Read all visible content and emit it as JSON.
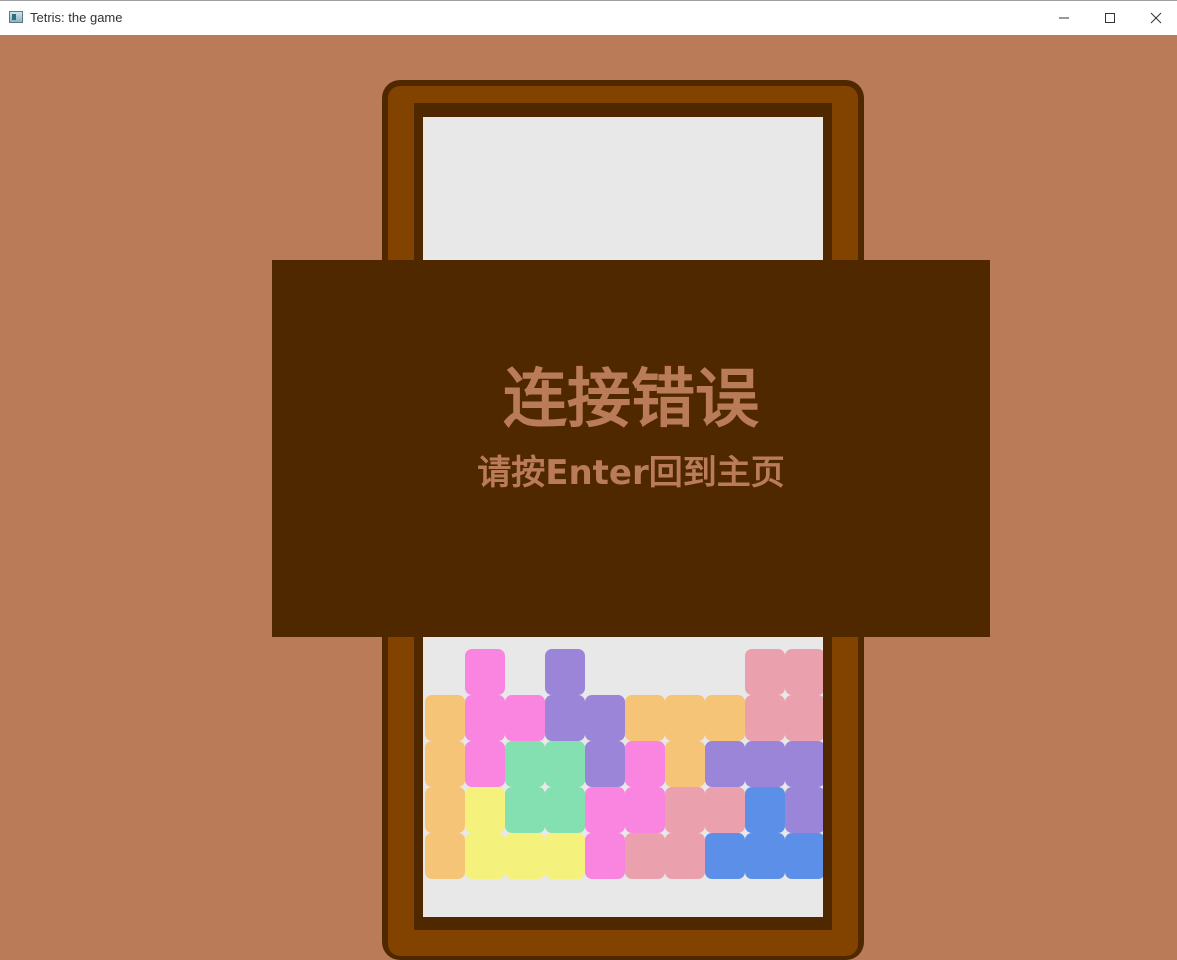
{
  "window": {
    "title": "Tetris: the game",
    "controls": [
      "minimize",
      "maximize",
      "close"
    ]
  },
  "colors": {
    "background": "#b97b58",
    "frame_dark": "#4f2800",
    "frame_mid": "#824200",
    "board": "#e8e8e8",
    "overlay": "#4f2800",
    "text": "#b97b58",
    "piece_orange": "#f6c476",
    "piece_pink": "#f985e0",
    "piece_purple": "#9b85d8",
    "piece_green": "#84e0b0",
    "piece_yellow": "#f4f27c",
    "piece_rose": "#eaa1ad",
    "piece_blue": "#5b8fe8"
  },
  "dialog": {
    "title": "连接错误",
    "subtitle": "请按Enter回到主页"
  },
  "board": {
    "columns": 10,
    "rows": 6,
    "cells": [
      {
        "col": 1,
        "row": 0,
        "color": "pink"
      },
      {
        "col": 3,
        "row": 0,
        "color": "purple"
      },
      {
        "col": 8,
        "row": 0,
        "color": "rose"
      },
      {
        "col": 9,
        "row": 0,
        "color": "rose"
      },
      {
        "col": 0,
        "row": 1,
        "color": "orange"
      },
      {
        "col": 1,
        "row": 1,
        "color": "pink"
      },
      {
        "col": 2,
        "row": 1,
        "color": "pink"
      },
      {
        "col": 3,
        "row": 1,
        "color": "purple"
      },
      {
        "col": 4,
        "row": 1,
        "color": "purple"
      },
      {
        "col": 5,
        "row": 1,
        "color": "orange"
      },
      {
        "col": 6,
        "row": 1,
        "color": "orange"
      },
      {
        "col": 7,
        "row": 1,
        "color": "orange"
      },
      {
        "col": 8,
        "row": 1,
        "color": "rose"
      },
      {
        "col": 9,
        "row": 1,
        "color": "rose"
      },
      {
        "col": 0,
        "row": 2,
        "color": "orange"
      },
      {
        "col": 1,
        "row": 2,
        "color": "pink"
      },
      {
        "col": 2,
        "row": 2,
        "color": "green"
      },
      {
        "col": 3,
        "row": 2,
        "color": "green"
      },
      {
        "col": 4,
        "row": 2,
        "color": "purple"
      },
      {
        "col": 5,
        "row": 2,
        "color": "pink"
      },
      {
        "col": 6,
        "row": 2,
        "color": "orange"
      },
      {
        "col": 7,
        "row": 2,
        "color": "purple"
      },
      {
        "col": 8,
        "row": 2,
        "color": "purple"
      },
      {
        "col": 9,
        "row": 2,
        "color": "purple"
      },
      {
        "col": 0,
        "row": 3,
        "color": "orange"
      },
      {
        "col": 1,
        "row": 3,
        "color": "yellow"
      },
      {
        "col": 2,
        "row": 3,
        "color": "green"
      },
      {
        "col": 3,
        "row": 3,
        "color": "green"
      },
      {
        "col": 4,
        "row": 3,
        "color": "pink"
      },
      {
        "col": 5,
        "row": 3,
        "color": "pink"
      },
      {
        "col": 6,
        "row": 3,
        "color": "rose"
      },
      {
        "col": 7,
        "row": 3,
        "color": "rose"
      },
      {
        "col": 8,
        "row": 3,
        "color": "blue"
      },
      {
        "col": 9,
        "row": 3,
        "color": "purple"
      },
      {
        "col": 0,
        "row": 4,
        "color": "orange"
      },
      {
        "col": 1,
        "row": 4,
        "color": "yellow"
      },
      {
        "col": 2,
        "row": 4,
        "color": "yellow"
      },
      {
        "col": 3,
        "row": 4,
        "color": "yellow"
      },
      {
        "col": 4,
        "row": 4,
        "color": "pink"
      },
      {
        "col": 5,
        "row": 4,
        "color": "rose"
      },
      {
        "col": 6,
        "row": 4,
        "color": "rose"
      },
      {
        "col": 7,
        "row": 4,
        "color": "blue"
      },
      {
        "col": 8,
        "row": 4,
        "color": "blue"
      },
      {
        "col": 9,
        "row": 4,
        "color": "blue"
      }
    ]
  }
}
